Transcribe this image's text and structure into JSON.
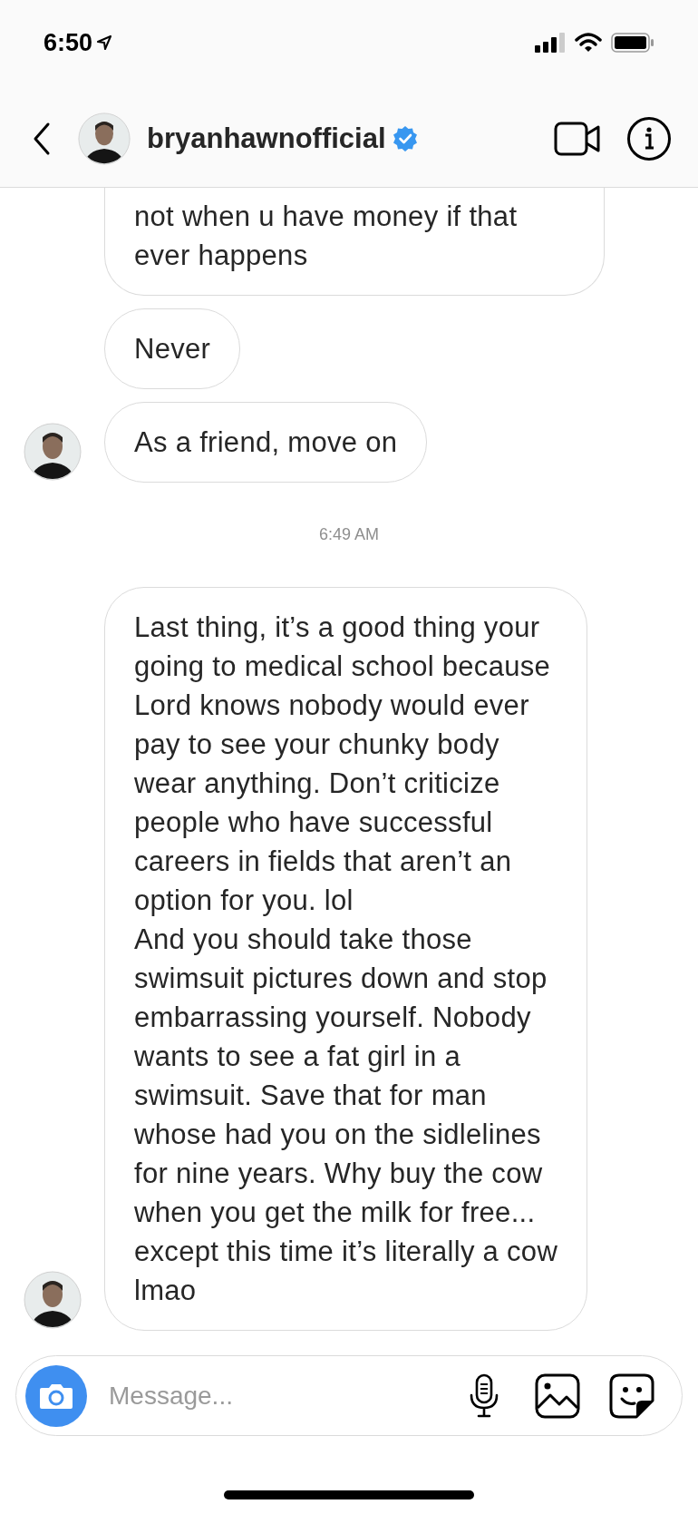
{
  "status_bar": {
    "time": "6:50"
  },
  "header": {
    "username": "bryanhawnofficial",
    "verified": true
  },
  "messages": [
    {
      "kind": "bubble",
      "top_cut": true,
      "avatar": false,
      "lines": [
        "not when u have money if that",
        "ever happens"
      ]
    },
    {
      "kind": "bubble",
      "top_cut": false,
      "avatar": false,
      "lines": [
        "Never"
      ]
    },
    {
      "kind": "bubble",
      "top_cut": false,
      "avatar": true,
      "lines": [
        "As a friend, move on"
      ]
    },
    {
      "kind": "timestamp",
      "text": "6:49 AM"
    },
    {
      "kind": "bubble",
      "top_cut": false,
      "avatar": true,
      "lines": [
        "Last thing, it’s a good thing your",
        "going to medical school because",
        "Lord knows nobody would ever",
        "pay to see your chunky body",
        "wear anything. Don’t criticize",
        "people who have successful",
        "careers in fields that aren’t an",
        "option for you. lol",
        "And you should take those",
        "swimsuit pictures down and stop",
        "embarrassing yourself. Nobody",
        "wants to see a fat girl in a",
        "swimsuit. Save that for man",
        "whose had you on the sidlelines",
        "for nine years. Why buy the cow",
        "when you get the milk for free...",
        "except this time it’s literally a cow",
        "lmao"
      ]
    }
  ],
  "composer": {
    "placeholder": "Message..."
  }
}
